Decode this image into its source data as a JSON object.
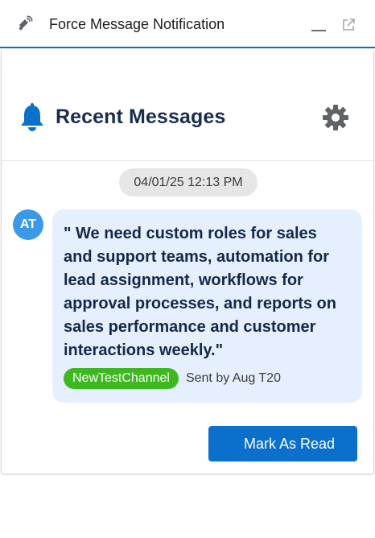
{
  "window": {
    "title": "Force Message Notification",
    "app_icon": "broadcast-bell-icon",
    "controls": [
      "minimize-icon",
      "popout-icon"
    ]
  },
  "header": {
    "title": "Recent Messages",
    "icon": "bell-icon",
    "settings_icon": "gear-icon"
  },
  "messages": [
    {
      "date": "04/01/25 12:13 PM",
      "avatar_initials": "AT",
      "text": "\" We need custom roles for sales and support teams, automation for lead assignment, workflows for approval processes, and reports on sales performance and customer interactions weekly.\"",
      "channel": "NewTestChannel",
      "sender": "Sent by Aug T20"
    }
  ],
  "actions": {
    "mark_read_label": "Mark As Read"
  },
  "colors": {
    "accent": "#0b6fcc",
    "title_text": "#1a2d4f",
    "bubble_bg": "#e5effd",
    "channel_badge": "#3eb81f",
    "avatar_bg": "#3b99e8"
  }
}
